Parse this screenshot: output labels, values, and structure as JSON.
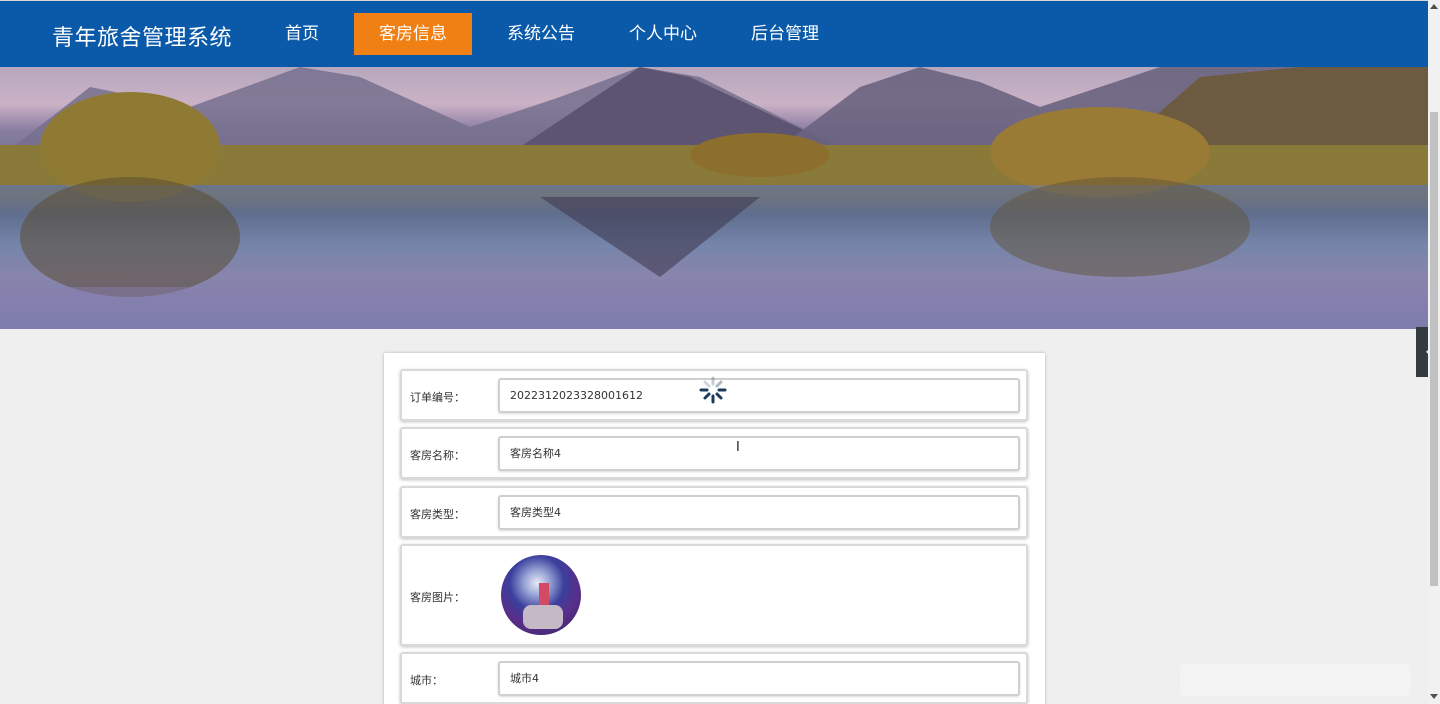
{
  "header": {
    "brand": "青年旅舍管理系统",
    "nav": [
      {
        "label": "首页",
        "active": false
      },
      {
        "label": "客房信息",
        "active": true
      },
      {
        "label": "系统公告",
        "active": false
      },
      {
        "label": "个人中心",
        "active": false
      },
      {
        "label": "后台管理",
        "active": false
      }
    ]
  },
  "banner": {
    "slide_count": 3,
    "active_slide": 1
  },
  "detail": {
    "order_no": {
      "label": "订单编号：",
      "value": "2022312023328001612"
    },
    "room_name": {
      "label": "客房名称：",
      "value": "客房名称4"
    },
    "room_type": {
      "label": "客房类型：",
      "value": "客房类型4"
    },
    "room_image": {
      "label": "客房图片："
    },
    "city": {
      "label": "城市：",
      "value": "城市4"
    }
  },
  "colors": {
    "header_bg": "#0b5aa9",
    "nav_active": "#f07f14",
    "page_bg": "#efefef"
  },
  "icons": {
    "side_toggle": "chevron-left-icon",
    "loading": "spinner-icon"
  }
}
